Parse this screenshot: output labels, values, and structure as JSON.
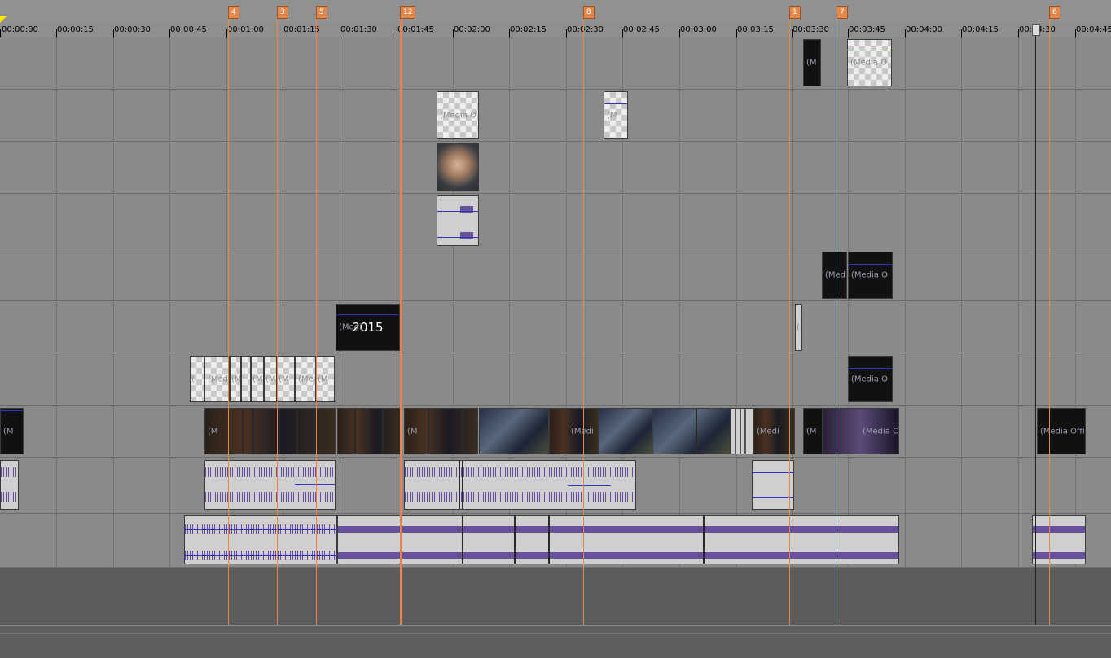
{
  "ruler": {
    "labels": [
      "00:00:00",
      "00:00:15",
      "00:00:30",
      "00:00:45",
      "00:01:00",
      "00:01:15",
      "00:01:30",
      "00:01:45",
      "00:02:00",
      "00:02:15",
      "00:02:30",
      "00:02:45",
      "00:03:00",
      "00:03:15",
      "00:03:30",
      "00:03:45",
      "00:04:00",
      "00:04:15",
      "00:04:30",
      "00:04:45"
    ]
  },
  "markers": [
    "4",
    "3",
    "5",
    "12",
    "8",
    "1",
    "7",
    "6"
  ],
  "clips": {
    "media_offline": "(Media Offline)",
    "media_offline_short": "(Media O",
    "media_offline_tiny": "(Medi",
    "media_offline_min": "(M",
    "media_offline_micro": "(",
    "title_2015": "2015"
  },
  "colors": {
    "marker": "#e3874a",
    "fade_handle": "#29c9d6",
    "envelope": "#2a34c8",
    "waveform": "#5b3f94"
  }
}
